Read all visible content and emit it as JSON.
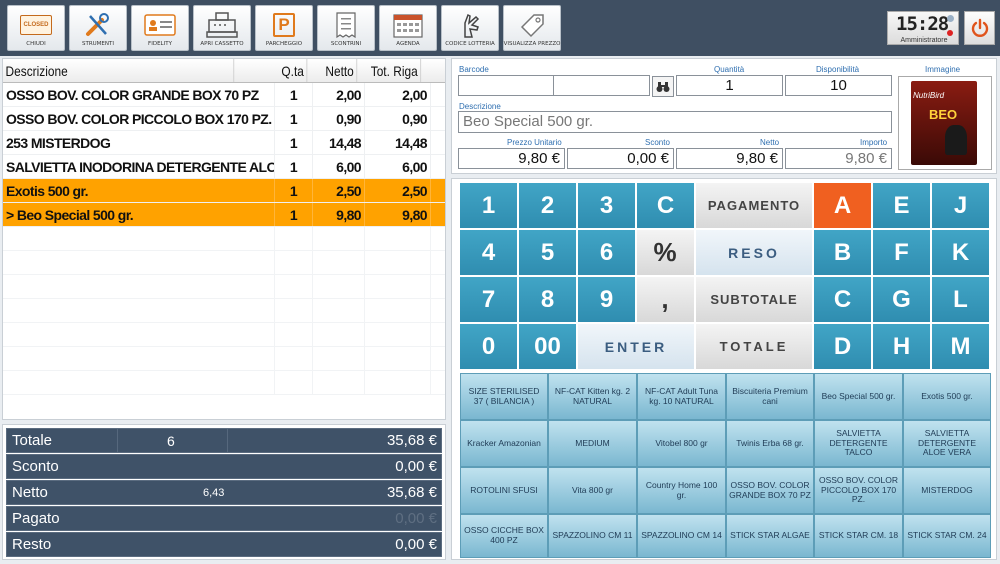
{
  "toolbar": {
    "buttons": [
      {
        "label": "CHIUDI",
        "badge": "CLOSED",
        "icon": "closed-sign-icon"
      },
      {
        "label": "STRUMENTI",
        "icon": "tools-icon"
      },
      {
        "label": "FIDELITY",
        "icon": "fidelity-card-icon"
      },
      {
        "label": "APRI CASSETTO",
        "icon": "cash-register-icon"
      },
      {
        "label": "PARCHEGGIO",
        "icon": "parking-icon"
      },
      {
        "label": "SCONTRINI",
        "icon": "receipt-icon"
      },
      {
        "label": "AGENDA",
        "icon": "calendar-icon"
      },
      {
        "label": "CODICE LOTTERIA",
        "icon": "lottery-hand-icon"
      },
      {
        "label": "VISUALIZZA PREZZO",
        "icon": "price-tag-icon"
      }
    ],
    "clock": {
      "time": "15:28",
      "user": "Amministratore"
    }
  },
  "receipt": {
    "headers": {
      "desc": "Descrizione",
      "qty": "Q.ta",
      "net": "Netto",
      "total": "Tot. Riga"
    },
    "rows": [
      {
        "desc": "OSSO BOV. COLOR GRANDE BOX 70 PZ",
        "qty": "1",
        "net": "2,00",
        "total": "2,00"
      },
      {
        "desc": "OSSO BOV. COLOR PICCOLO BOX 170 PZ.",
        "qty": "1",
        "net": "0,90",
        "total": "0,90"
      },
      {
        "desc": "253 MISTERDOG",
        "qty": "1",
        "net": "14,48",
        "total": "14,48"
      },
      {
        "desc": "SALVIETTA INODORINA DETERGENTE ALOE VERA",
        "qty": "1",
        "net": "6,00",
        "total": "6,00"
      },
      {
        "desc": "Exotis  500 gr.",
        "qty": "1",
        "net": "2,50",
        "total": "2,50"
      },
      {
        "desc": "> Beo Special  500 gr.",
        "qty": "1",
        "net": "9,80",
        "total": "9,80"
      }
    ]
  },
  "totals": {
    "totale": {
      "label": "Totale",
      "count": "6",
      "value": "35,68 €"
    },
    "sconto": {
      "label": "Sconto",
      "value": "0,00 €"
    },
    "netto": {
      "label": "Netto",
      "extra": "6,43",
      "value": "35,68 €"
    },
    "pagato": {
      "label": "Pagato",
      "value": "0,00 €"
    },
    "resto": {
      "label": "Resto",
      "value": "0,00 €"
    }
  },
  "form": {
    "barcode_label": "Barcode",
    "barcode_value": "",
    "qty_label": "Quantità",
    "qty_value": "1",
    "avail_label": "Disponibilità",
    "avail_value": "10",
    "image_label": "Immagine",
    "desc_label": "Descrizione",
    "desc_value": "Beo Special  500 gr.",
    "unit_price_label": "Prezzo Unitario",
    "unit_price_value": "9,80 €",
    "discount_label": "Sconto",
    "discount_value": "0,00 €",
    "net_label": "Netto",
    "net_value": "9,80 €",
    "amount_label": "Importo",
    "amount_value": "9,80 €",
    "product_image_text": "BEO",
    "product_image_brand": "NutriBird"
  },
  "keypad": {
    "digits": [
      "1",
      "2",
      "3",
      "4",
      "5",
      "6",
      "7",
      "8",
      "9",
      "0",
      "00"
    ],
    "clear": "C",
    "percent": "%",
    "comma": ",",
    "pagamento": "PAGAMENTO",
    "reso": "RESO",
    "subtotale": "SUBTOTALE",
    "enter": "ENTER",
    "totale": "TOTALE",
    "letters": [
      "A",
      "E",
      "J",
      "B",
      "F",
      "K",
      "C",
      "G",
      "L",
      "D",
      "H",
      "M"
    ]
  },
  "products": [
    "SIZE STERILISED 37 ( BILANCIA )",
    "NF-CAT Kitten kg. 2 NATURAL",
    "NF-CAT Adult Tuna kg. 10 NATURAL",
    "Biscuiteria Premium cani",
    "Beo Special  500 gr.",
    "Exotis  500 gr.",
    "Kracker Amazonian",
    "MEDIUM",
    "Vitobel 800 gr",
    "Twinis Erba 68 gr.",
    "SALVIETTA DETERGENTE TALCO",
    "SALVIETTA DETERGENTE ALOE VERA",
    "ROTOLINI SFUSI",
    "Vita 800 gr",
    "Country Home 100 gr.",
    "OSSO BOV. COLOR GRANDE BOX 70 PZ",
    "OSSO BOV. COLOR PICCOLO BOX 170 PZ.",
    "MISTERDOG",
    "OSSO CICCHE BOX 400 PZ",
    "SPAZZOLINO CM 11",
    "SPAZZOLINO CM 14",
    "STICK STAR ALGAE",
    "STICK STAR CM. 18",
    "STICK STAR CM. 24"
  ],
  "colors": {
    "toolbar": "#3f4f62",
    "highlight": "#ffa200",
    "key_blue": "#3a9cbe",
    "key_orange": "#f06020",
    "totals_bg": "#3f5268"
  }
}
